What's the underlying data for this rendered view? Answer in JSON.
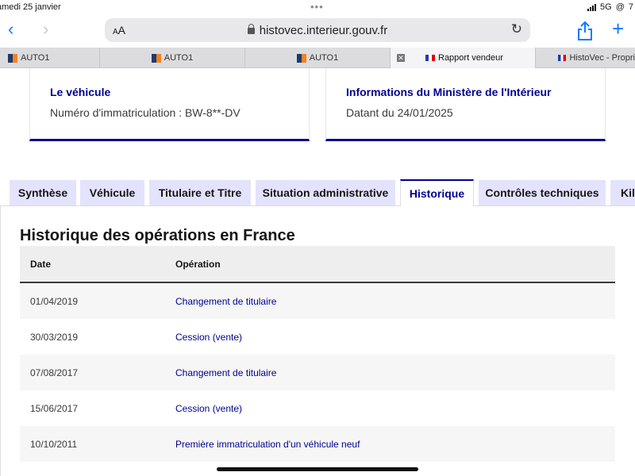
{
  "status_bar": {
    "date": "amedi 25 janvier",
    "network": "5G",
    "battery": "7"
  },
  "browser": {
    "text_size_label": "AA",
    "url": "histovec.interieur.gouv.fr"
  },
  "tabs": [
    {
      "label": "AUTO1",
      "favicon": "auto1-icon"
    },
    {
      "label": "AUTO1",
      "favicon": "auto1-icon"
    },
    {
      "label": "AUTO1",
      "favicon": "auto1-icon"
    },
    {
      "label": "Rapport vendeur",
      "favicon": "french-flag-icon",
      "active": true
    },
    {
      "label": "HistoVec - Propri",
      "favicon": "french-flag-icon"
    }
  ],
  "vehicle_card": {
    "title": "Le véhicule",
    "subtitle": "Numéro d'immatriculation : BW-8**-DV"
  },
  "ministry_card": {
    "title": "Informations du Ministère de l'Intérieur",
    "subtitle": "Datant du 24/01/2025"
  },
  "section_tabs": [
    {
      "label": "Synthèse"
    },
    {
      "label": "Véhicule"
    },
    {
      "label": "Titulaire et Titre"
    },
    {
      "label": "Situation administrative"
    },
    {
      "label": "Historique",
      "active": true
    },
    {
      "label": "Contrôles techniques"
    },
    {
      "label": "Kilo"
    }
  ],
  "history": {
    "title": "Historique des opérations en France",
    "columns": [
      "Date",
      "Opération"
    ],
    "rows": [
      {
        "date": "01/04/2019",
        "operation": "Changement de titulaire"
      },
      {
        "date": "30/03/2019",
        "operation": "Cession (vente)"
      },
      {
        "date": "07/08/2017",
        "operation": "Changement de titulaire"
      },
      {
        "date": "15/06/2017",
        "operation": "Cession (vente)"
      },
      {
        "date": "10/10/2011",
        "operation": "Première immatriculation d'un véhicule neuf"
      }
    ]
  },
  "colors": {
    "accent": "#000091",
    "tab_bg": "#e3e3fd",
    "link": "#0a7bff"
  }
}
